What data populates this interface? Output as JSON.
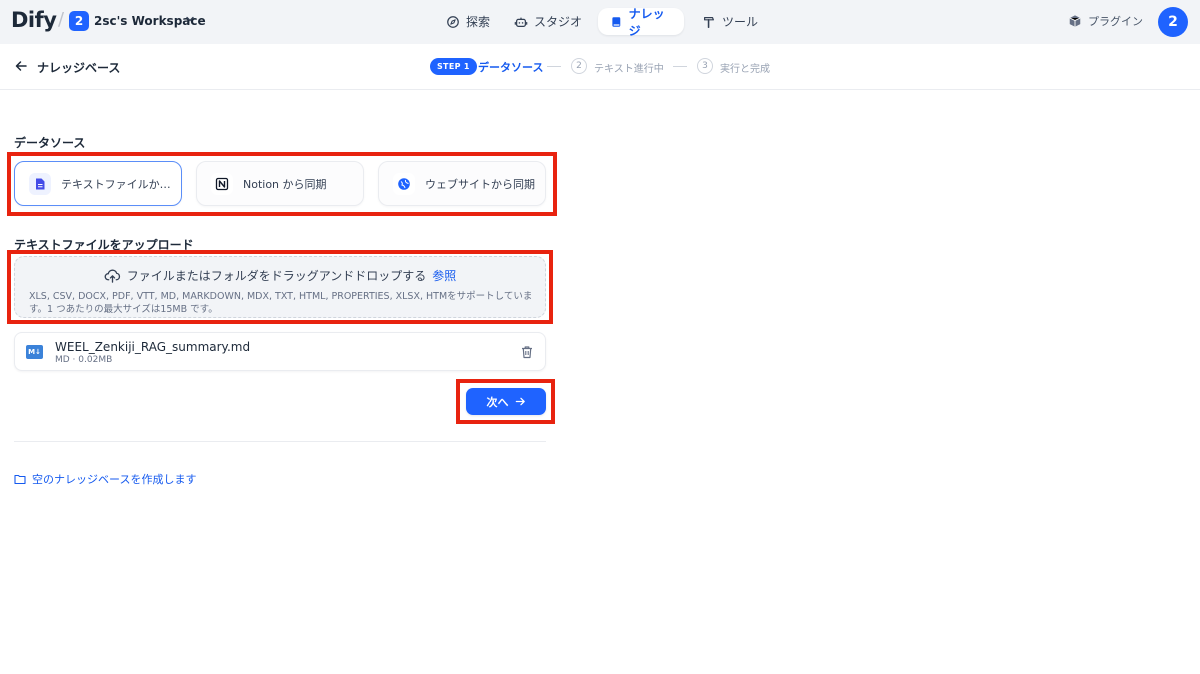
{
  "app": {
    "logo": "Dify"
  },
  "workspace": {
    "badge": "2",
    "name": "2sc's Workspace"
  },
  "nav": {
    "explore": "探索",
    "studio": "スタジオ",
    "knowledge": "ナレッジ",
    "tools": "ツール"
  },
  "plugin_label": "プラグイン",
  "avatar_initial": "2",
  "page": {
    "back_title": "ナレッジベース",
    "steps": {
      "step1_badge": "STEP 1",
      "step1_label": "データソース",
      "step2_num": "2",
      "step2_label": "テキスト進行中",
      "step3_num": "3",
      "step3_label": "実行と完成"
    }
  },
  "datasource": {
    "title": "データソース",
    "options": [
      {
        "label": "テキストファイルか…",
        "selected": true,
        "icon": "file-text-icon"
      },
      {
        "label": "Notion から同期",
        "selected": false,
        "icon": "notion-icon"
      },
      {
        "label": "ウェブサイトから同期",
        "selected": false,
        "icon": "globe-icon"
      }
    ]
  },
  "upload": {
    "title": "テキストファイルをアップロード",
    "drop_text": "ファイルまたはフォルダをドラッグアンドドロップする",
    "browse_link": "参照",
    "supported": "XLS, CSV, DOCX, PDF, VTT, MD, MARKDOWN, MDX, TXT, HTML, PROPERTIES, XLSX, HTMをサポートしています。1 つあたりの最大サイズは15MB です。"
  },
  "file": {
    "icon_text": "M↓",
    "name": "WEEL_Zenkiji_RAG_summary.md",
    "meta": "MD · 0.02MB"
  },
  "next_button": "次へ",
  "empty_kb_link": "空のナレッジベースを作成します",
  "colors": {
    "accent": "#1f63ff",
    "link": "#155aef",
    "annotation_red": "#e8230f"
  }
}
